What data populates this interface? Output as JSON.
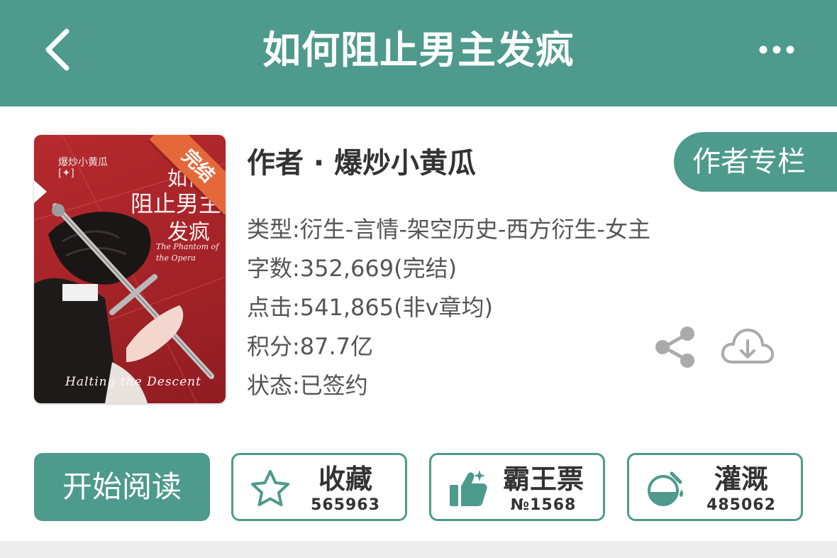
{
  "header": {
    "title": "如何阻止男主发疯"
  },
  "book": {
    "cover": {
      "badge": "完结",
      "author": "爆炒小黄瓜",
      "author_tag": "[✦]",
      "title_line1": "如何",
      "title_line2": "阻止男主",
      "title_line3": "发疯",
      "subtitle": "The Phantom of the Opera",
      "bottom_text": "Halting the Descent"
    },
    "author_line": "作者 · 爆炒小黄瓜",
    "author_column_button": "作者专栏",
    "genre": "类型:衍生-言情-架空历史-西方衍生-女主",
    "word_count": "字数:352,669(完结)",
    "clicks": "点击:541,865(非v章均)",
    "score": "积分:87.7亿",
    "status": "状态:已签约"
  },
  "actions": {
    "read": "开始阅读",
    "favorite": {
      "label": "收藏",
      "count": "565963"
    },
    "vote": {
      "label": "霸王票",
      "count": "№1568"
    },
    "nourish": {
      "label": "灌溉",
      "count": "485062"
    }
  },
  "colors": {
    "primary": "#4e9a8c",
    "cover_red": "#b52a2e",
    "badge_orange": "#e5683a"
  },
  "icons": {
    "back": "chevron-left-icon",
    "more": "more-horizontal-icon",
    "share": "share-icon",
    "download": "cloud-download-icon",
    "favorite": "star-icon",
    "vote": "thumbs-up-icon",
    "nourish": "flask-icon"
  }
}
